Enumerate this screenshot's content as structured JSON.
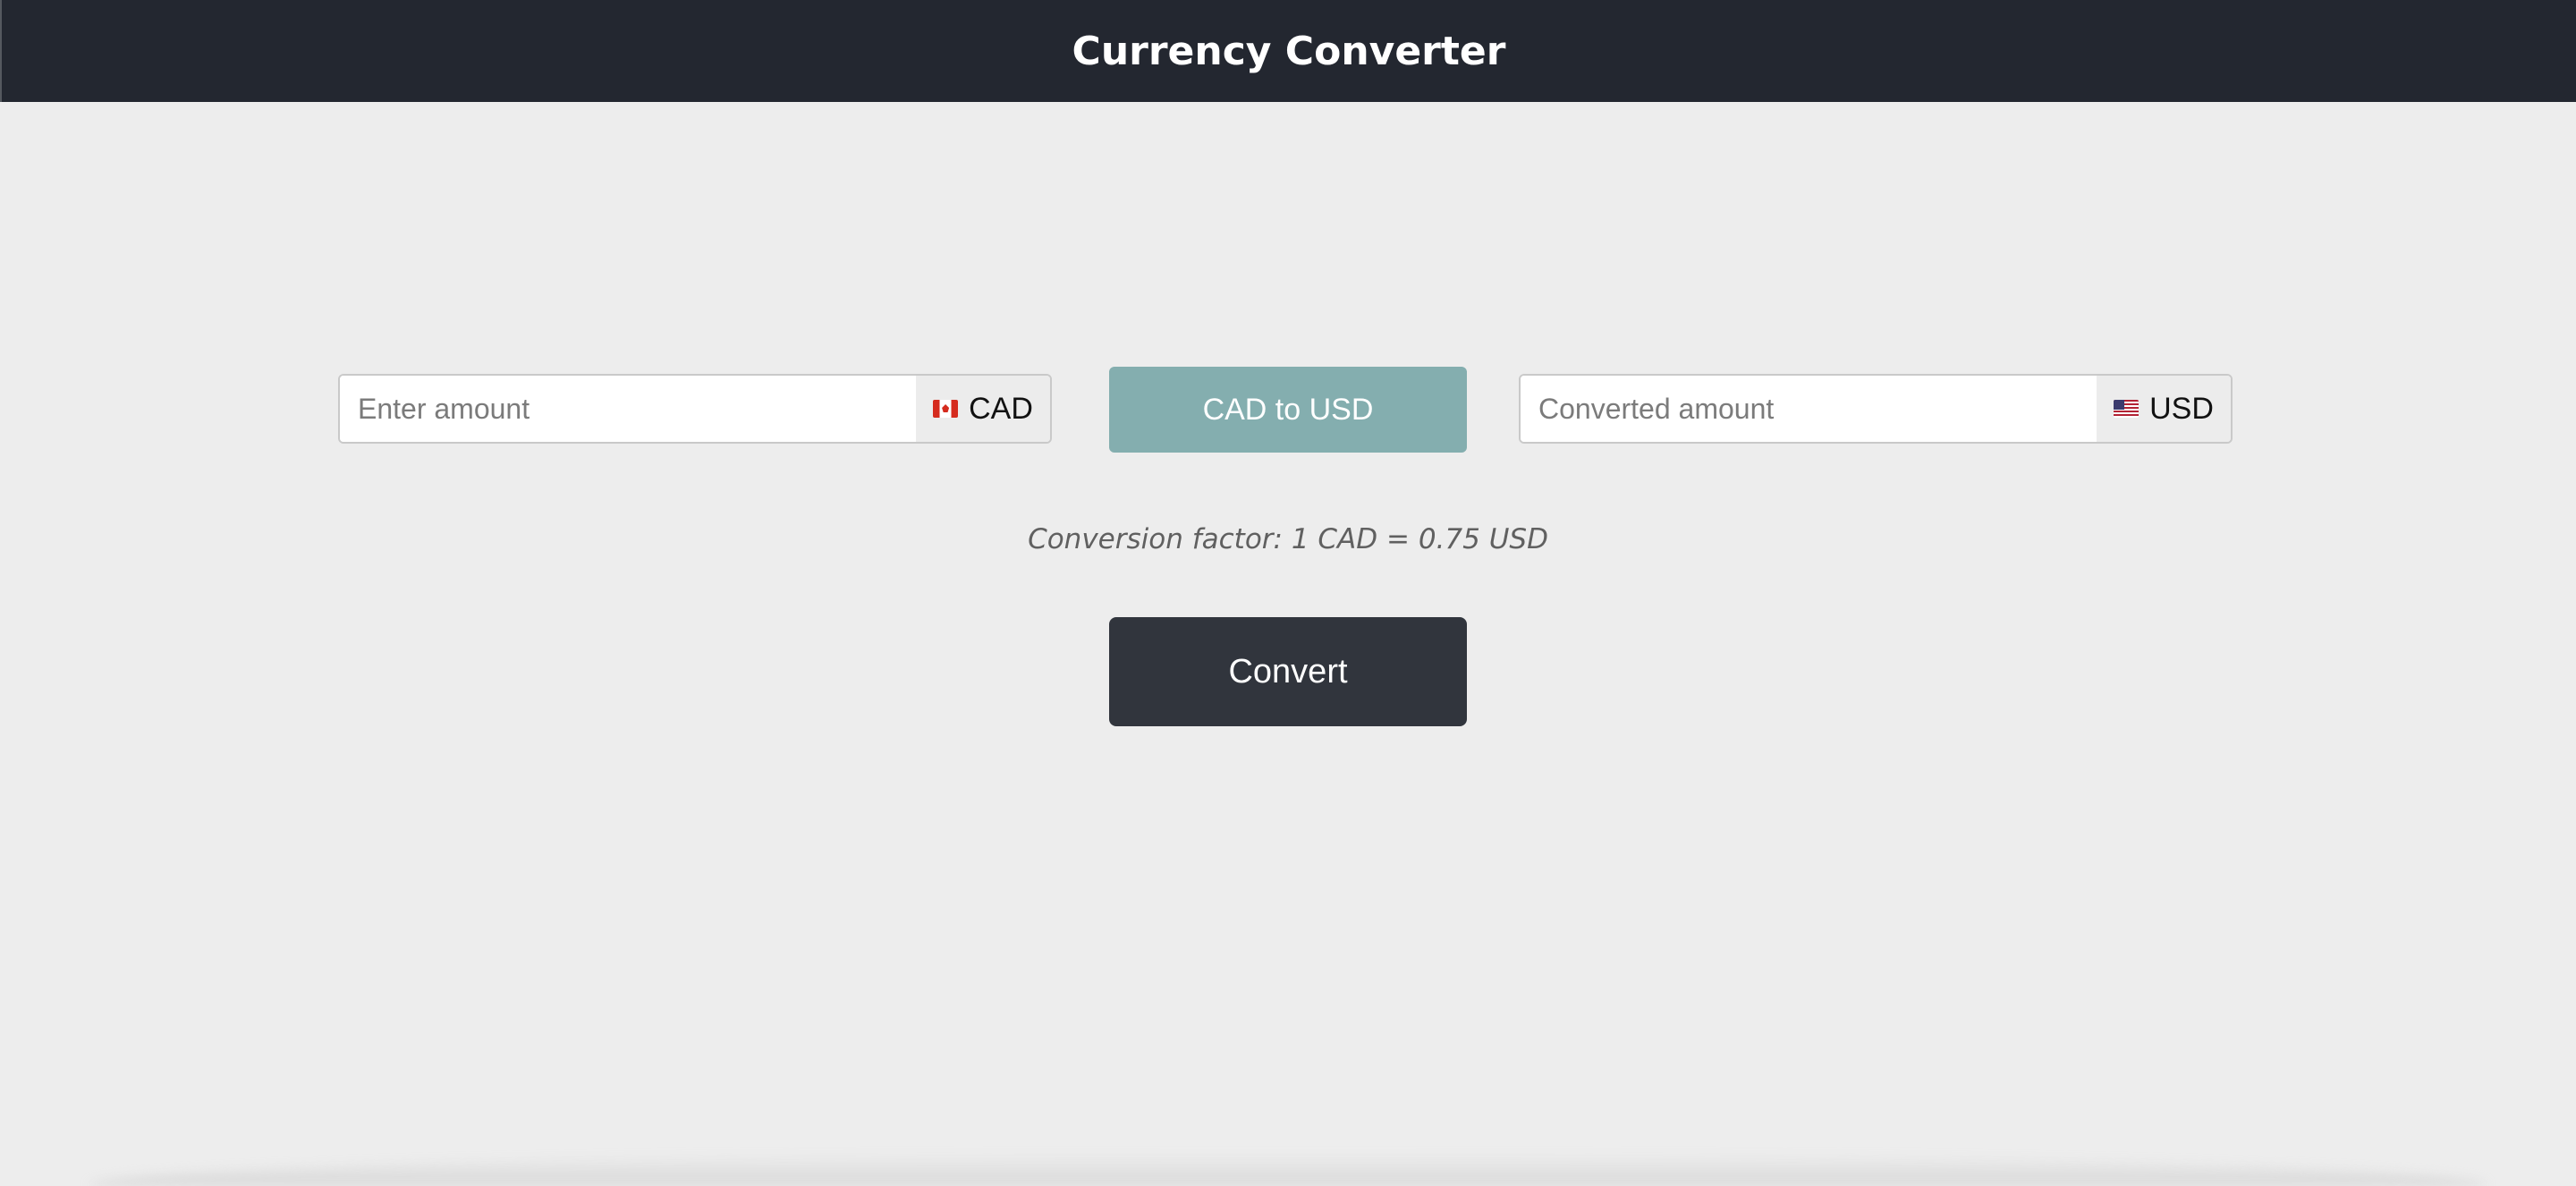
{
  "header": {
    "title": "Currency Converter"
  },
  "converter": {
    "from": {
      "value": "",
      "placeholder": "Enter amount",
      "currency": "CAD",
      "flag_icon": "canada-flag-icon"
    },
    "direction_button": "CAD to USD",
    "to": {
      "value": "",
      "placeholder": "Converted amount",
      "currency": "USD",
      "flag_icon": "us-flag-icon"
    },
    "conversion_factor": "Conversion factor: 1 CAD = 0.75 USD",
    "convert_button": "Convert"
  },
  "colors": {
    "header_bg": "#232730",
    "page_bg": "#ededed",
    "direction_button_bg": "#84aeaf",
    "convert_button_bg": "#31353d"
  }
}
